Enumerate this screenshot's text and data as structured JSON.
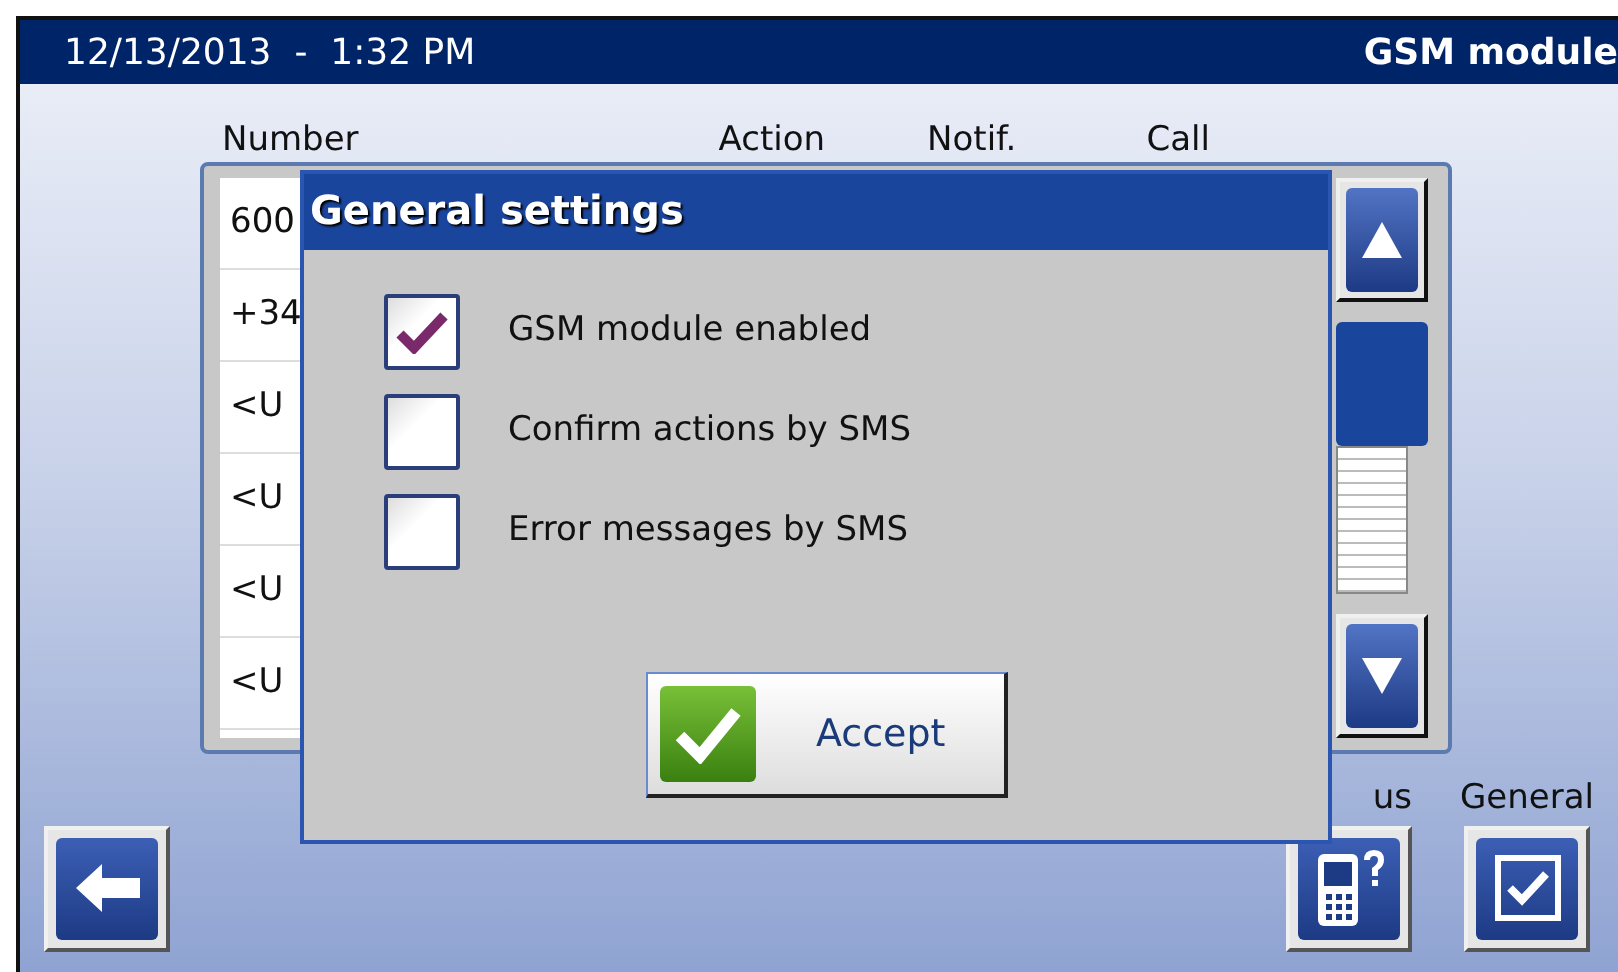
{
  "header": {
    "datetime": "12/13/2013  -  1:32 PM",
    "title": "GSM module"
  },
  "table": {
    "columns": [
      "Number",
      "Action",
      "Notif.",
      "Call"
    ],
    "rows": [
      {
        "number": "600"
      },
      {
        "number": "+34"
      },
      {
        "number": "<U"
      },
      {
        "number": "<U"
      },
      {
        "number": "<U"
      },
      {
        "number": "<U"
      }
    ]
  },
  "dialog": {
    "title": "General settings",
    "options": [
      {
        "label": "GSM module enabled",
        "checked": true
      },
      {
        "label": "Confirm actions by SMS",
        "checked": false
      },
      {
        "label": "Error messages by SMS",
        "checked": false
      }
    ],
    "button": "Accept"
  },
  "footer": {
    "labels": [
      "us",
      "General"
    ]
  }
}
